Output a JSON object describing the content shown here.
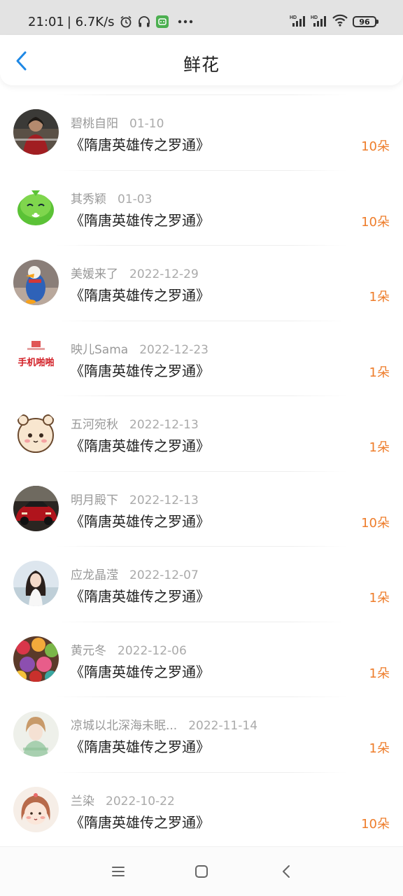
{
  "status_bar": {
    "time": "21:01",
    "speed": "| 6.7K/s",
    "battery": "96",
    "hd1": "HD",
    "hd2": "HD"
  },
  "header": {
    "title": "鲜花"
  },
  "accent": "#1e88e5",
  "count_color": "#ee7d2b",
  "items": [
    {
      "name": "碧桃自阳",
      "date": "01-10",
      "book": "《隋唐英雄传之罗通》",
      "count": "10朵"
    },
    {
      "name": "其秀颖",
      "date": "01-03",
      "book": "《隋唐英雄传之罗通》",
      "count": "10朵"
    },
    {
      "name": "美媛来了",
      "date": "2022-12-29",
      "book": "《隋唐英雄传之罗通》",
      "count": "1朵"
    },
    {
      "name": "映儿Sama",
      "date": "2022-12-23",
      "book": "《隋唐英雄传之罗通》",
      "count": "1朵"
    },
    {
      "name": "五河宛秋",
      "date": "2022-12-13",
      "book": "《隋唐英雄传之罗通》",
      "count": "1朵"
    },
    {
      "name": "明月殿下",
      "date": "2022-12-13",
      "book": "《隋唐英雄传之罗通》",
      "count": "10朵"
    },
    {
      "name": "应龙晶滢",
      "date": "2022-12-07",
      "book": "《隋唐英雄传之罗通》",
      "count": "1朵"
    },
    {
      "name": "黄元冬",
      "date": "2022-12-06",
      "book": "《隋唐英雄传之罗通》",
      "count": "1朵"
    },
    {
      "name": "凉城以北深海未眠...",
      "date": "2022-11-14",
      "book": "《隋唐英雄传之罗通》",
      "count": "1朵"
    },
    {
      "name": "兰染",
      "date": "2022-10-22",
      "book": "《隋唐英雄传之罗通》",
      "count": "10朵"
    }
  ],
  "avatar_texts": {
    "item4_logo": "手机啪啪"
  }
}
